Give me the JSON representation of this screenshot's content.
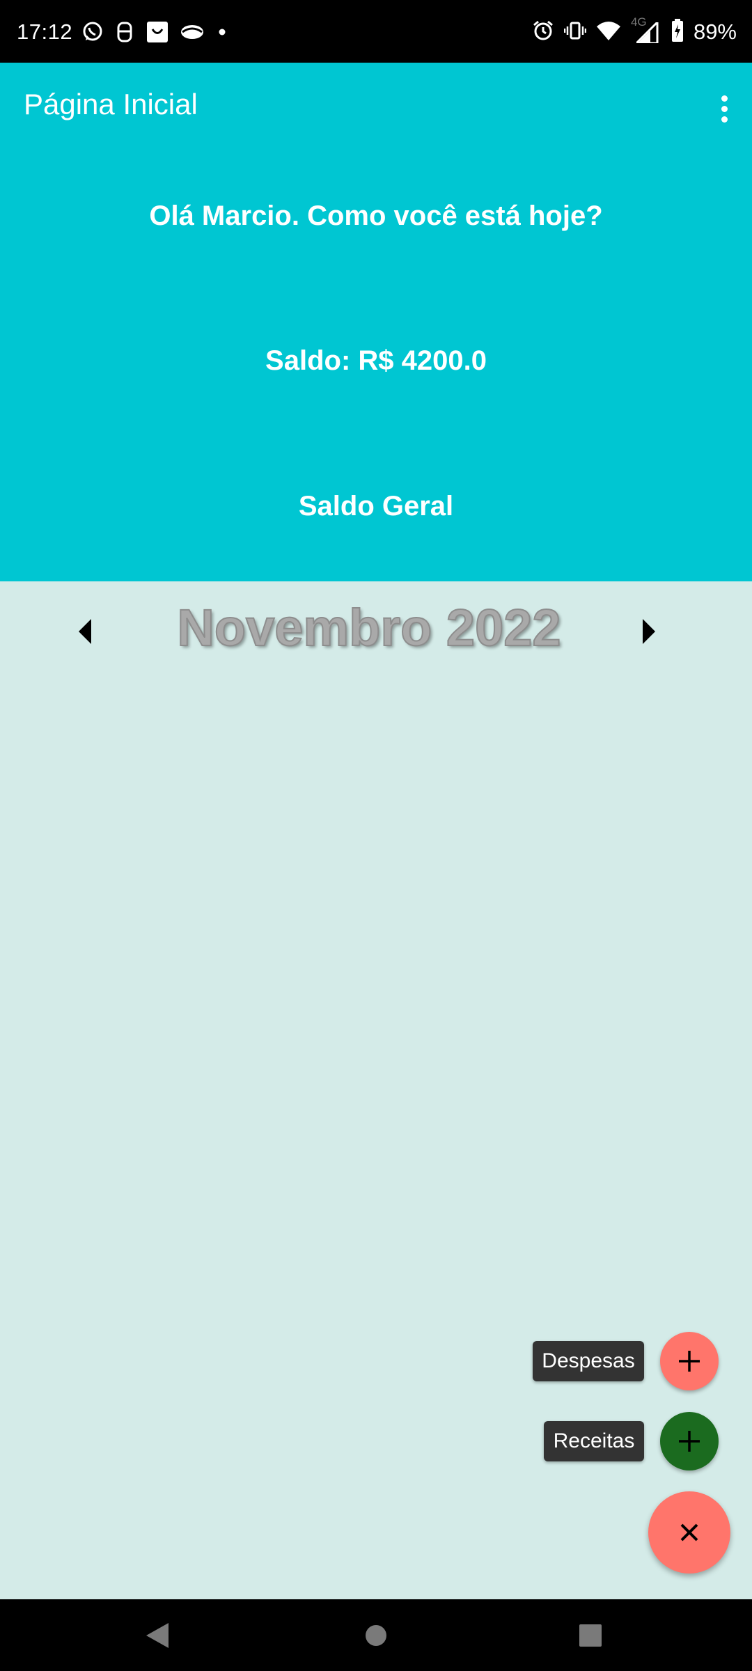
{
  "status_bar": {
    "time": "17:12",
    "battery": "89%",
    "network": "4G",
    "left_icons": [
      "whatsapp-icon",
      "notification-app-icon",
      "shopping-bag-icon",
      "eye-app-icon",
      "dot-icon"
    ],
    "right_icons": [
      "alarm-icon",
      "vibrate-icon",
      "wifi-icon",
      "signal-icon",
      "battery-charging-icon"
    ]
  },
  "app_bar": {
    "title": "Página Inicial",
    "menu_icon": "more-vertical-icon"
  },
  "header": {
    "greeting": "Olá Marcio. Como você está hoje?",
    "balance": "Saldo: R$ 4200.0",
    "balance_label": "Saldo Geral"
  },
  "month_selector": {
    "label": "Novembro 2022",
    "prev_icon": "arrow-left-icon",
    "next_icon": "arrow-right-icon"
  },
  "fab": {
    "expenses_label": "Despesas",
    "income_label": "Receitas",
    "expenses_color": "#ff756b",
    "income_color": "#1b6b1f",
    "main_color": "#ff756b"
  },
  "colors": {
    "header_bg": "#00c6d2",
    "body_bg": "#d4ebe8"
  }
}
